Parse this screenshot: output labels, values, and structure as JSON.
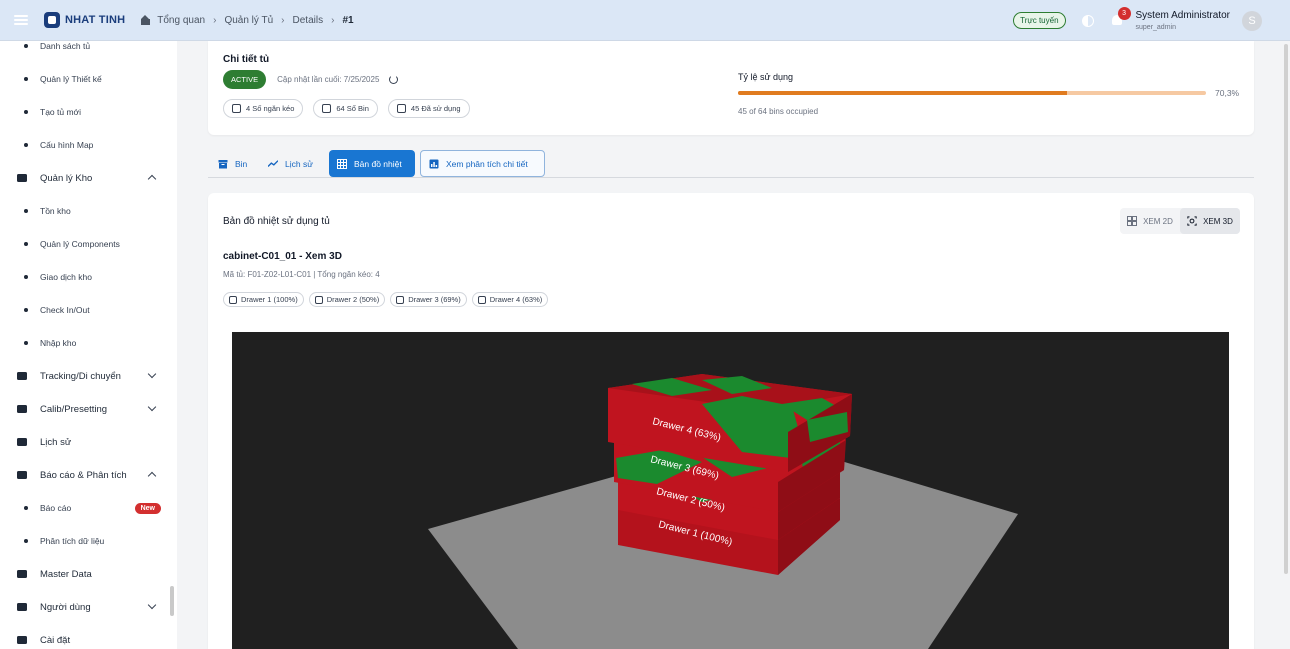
{
  "topbar": {
    "brand": "NHAT TINH",
    "breadcrumb": [
      "Tổng quan",
      "Quản lý Tủ",
      "Details",
      "#1"
    ],
    "online": "Trực tuyến",
    "notification_count": "3",
    "user_name": "System Administrator",
    "user_role": "super_admin",
    "avatar_letter": "S"
  },
  "sidebar": {
    "items": [
      {
        "label": "Danh sách tủ",
        "kind": "sub"
      },
      {
        "label": "Quản lý Thiết kế",
        "kind": "sub"
      },
      {
        "label": "Tạo tủ mới",
        "kind": "sub"
      },
      {
        "label": "Cấu hình Map",
        "kind": "sub"
      },
      {
        "label": "Quản lý Kho",
        "kind": "main",
        "icon": "archive-icon",
        "chevron": "up"
      },
      {
        "label": "Tồn kho",
        "kind": "sub"
      },
      {
        "label": "Quản lý Components",
        "kind": "sub"
      },
      {
        "label": "Giao dịch kho",
        "kind": "sub"
      },
      {
        "label": "Check In/Out",
        "kind": "sub"
      },
      {
        "label": "Nhập kho",
        "kind": "sub"
      },
      {
        "label": "Tracking/Di chuyển",
        "kind": "main",
        "icon": "truck-icon",
        "chevron": "down"
      },
      {
        "label": "Calib/Presetting",
        "kind": "main",
        "icon": "flask-icon",
        "chevron": "down"
      },
      {
        "label": "Lịch sử",
        "kind": "main",
        "icon": "history-icon"
      },
      {
        "label": "Báo cáo & Phân tích",
        "kind": "main",
        "icon": "report-icon",
        "chevron": "up"
      },
      {
        "label": "Báo cáo",
        "kind": "sub",
        "badge": "New"
      },
      {
        "label": "Phân tích dữ liệu",
        "kind": "sub"
      },
      {
        "label": "Master Data",
        "kind": "main",
        "icon": "database-icon"
      },
      {
        "label": "Người dùng",
        "kind": "main",
        "icon": "users-icon",
        "chevron": "down"
      },
      {
        "label": "Cài đặt",
        "kind": "main",
        "icon": "gear-icon"
      }
    ]
  },
  "detail": {
    "title": "Chi tiết tủ",
    "status": "ACTIVE",
    "updated": "Cập nhật lần cuối: 7/25/2025",
    "chips": [
      "4 Số ngăn kéo",
      "64 Số Bin",
      "45 Đã sử dụng"
    ],
    "usage_title": "Tỷ lệ sử dụng",
    "usage_percent": 70.3,
    "usage_label": "70,3%",
    "usage_sub": "45 of 64 bins occupied"
  },
  "tabs": [
    {
      "label": "Bin",
      "icon": "archive-icon"
    },
    {
      "label": "Lịch sử",
      "icon": "trend-icon"
    },
    {
      "label": "Bản đồ nhiệt",
      "icon": "grid-icon",
      "active": true
    },
    {
      "label": "Xem phân tích chi tiết",
      "icon": "analytics-icon"
    }
  ],
  "heatmap": {
    "title": "Bản đồ nhiệt sử dụng tủ",
    "view_2d": "XEM 2D",
    "view_3d": "XEM 3D",
    "cabinet_title": "cabinet-C01_01 - Xem 3D",
    "cabinet_sub": "Mã tủ: F01-Z02-L01-C01 | Tổng ngăn kéo: 4",
    "drawers": [
      "Drawer 1 (100%)",
      "Drawer 2 (50%)",
      "Drawer 3 (69%)",
      "Drawer 4 (63%)"
    ],
    "drawer_labels_3d": [
      "Drawer 1 (100%)",
      "Drawer 2 (50%)",
      "Drawer 3 (69%)",
      "Drawer 4 (63%)"
    ],
    "colors": {
      "occupied": "#c0141f",
      "free": "#1b8a2e",
      "floor": "#8c8c8c",
      "background": "#202020"
    }
  }
}
